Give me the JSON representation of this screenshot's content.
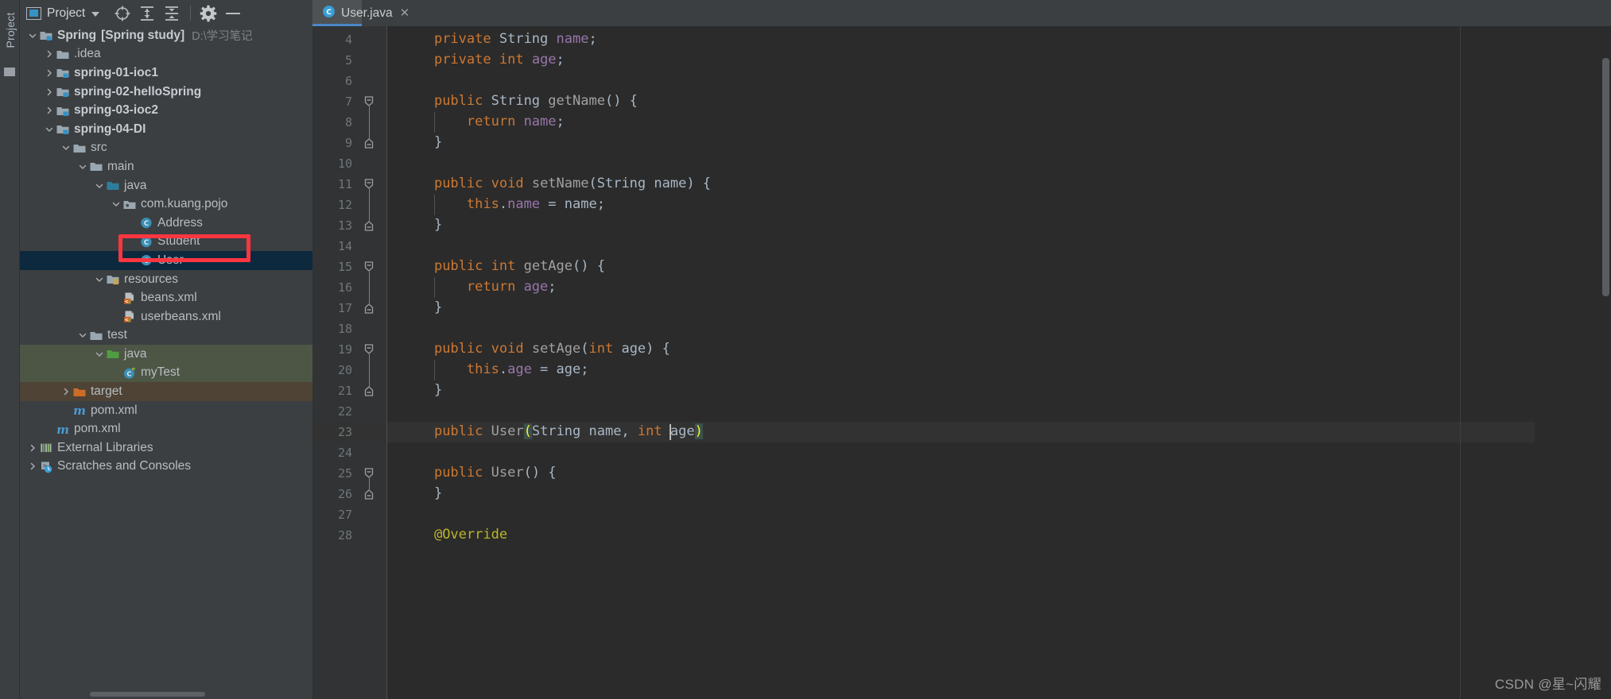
{
  "window": {
    "tool_window_label": "Project"
  },
  "project_header": {
    "title": "Project",
    "icons": [
      {
        "name": "project-view-icon",
        "glyph": "window"
      },
      {
        "name": "caret-down-icon",
        "glyph": "caret"
      },
      {
        "name": "locate-target-icon",
        "glyph": "crosshair"
      },
      {
        "name": "expand-all-icon",
        "glyph": "expand"
      },
      {
        "name": "collapse-all-icon",
        "glyph": "collapse"
      },
      {
        "name": "settings-gear-icon",
        "glyph": "gear"
      },
      {
        "name": "hide-panel-icon",
        "glyph": "minus"
      }
    ]
  },
  "tree": {
    "nodes": [
      {
        "label": "Spring",
        "suffix": "[Spring study]",
        "path": "D:\\学习笔记",
        "icon": "module-folder-icon",
        "depth": 0,
        "arrow": "down",
        "bold": true,
        "state": "normal"
      },
      {
        "label": ".idea",
        "icon": "folder-icon",
        "depth": 1,
        "arrow": "right",
        "bold": false,
        "state": "normal"
      },
      {
        "label": "spring-01-ioc1",
        "icon": "module-folder-icon",
        "depth": 1,
        "arrow": "right",
        "bold": true,
        "state": "normal"
      },
      {
        "label": "spring-02-helloSpring",
        "icon": "module-folder-icon",
        "depth": 1,
        "arrow": "right",
        "bold": true,
        "state": "normal"
      },
      {
        "label": "spring-03-ioc2",
        "icon": "module-folder-icon",
        "depth": 1,
        "arrow": "right",
        "bold": true,
        "state": "normal"
      },
      {
        "label": "spring-04-DI",
        "icon": "module-folder-icon",
        "depth": 1,
        "arrow": "down",
        "bold": true,
        "state": "normal"
      },
      {
        "label": "src",
        "icon": "folder-icon",
        "depth": 2,
        "arrow": "down",
        "bold": false,
        "state": "normal"
      },
      {
        "label": "main",
        "icon": "folder-icon",
        "depth": 3,
        "arrow": "down",
        "bold": false,
        "state": "normal"
      },
      {
        "label": "java",
        "icon": "source-root-icon",
        "depth": 4,
        "arrow": "down",
        "bold": false,
        "state": "normal"
      },
      {
        "label": "com.kuang.pojo",
        "icon": "package-icon",
        "depth": 5,
        "arrow": "down",
        "bold": false,
        "state": "normal"
      },
      {
        "label": "Address",
        "icon": "java-class-icon",
        "depth": 6,
        "arrow": "none",
        "bold": false,
        "state": "normal"
      },
      {
        "label": "Student",
        "icon": "java-class-icon",
        "depth": 6,
        "arrow": "none",
        "bold": false,
        "state": "normal"
      },
      {
        "label": "User",
        "icon": "java-class-icon",
        "depth": 6,
        "arrow": "none",
        "bold": false,
        "state": "selected"
      },
      {
        "label": "resources",
        "icon": "resource-root-icon",
        "depth": 4,
        "arrow": "down",
        "bold": false,
        "state": "normal"
      },
      {
        "label": "beans.xml",
        "icon": "spring-xml-icon",
        "depth": 5,
        "arrow": "none",
        "bold": false,
        "state": "normal"
      },
      {
        "label": "userbeans.xml",
        "icon": "spring-xml-icon",
        "depth": 5,
        "arrow": "none",
        "bold": false,
        "state": "normal"
      },
      {
        "label": "test",
        "icon": "folder-icon",
        "depth": 3,
        "arrow": "down",
        "bold": false,
        "state": "normal"
      },
      {
        "label": "java",
        "icon": "test-source-root-icon",
        "depth": 4,
        "arrow": "down",
        "bold": false,
        "state": "test"
      },
      {
        "label": "myTest",
        "icon": "java-test-class-icon",
        "depth": 5,
        "arrow": "none",
        "bold": false,
        "state": "test"
      },
      {
        "label": "target",
        "icon": "excluded-folder-icon",
        "depth": 2,
        "arrow": "right",
        "bold": false,
        "state": "target"
      },
      {
        "label": "pom.xml",
        "icon": "maven-icon",
        "depth": 2,
        "arrow": "none",
        "bold": false,
        "state": "normal"
      },
      {
        "label": "pom.xml",
        "icon": "maven-icon",
        "depth": 1,
        "arrow": "none",
        "bold": false,
        "state": "normal"
      },
      {
        "label": "External Libraries",
        "icon": "libraries-icon",
        "depth": 0,
        "arrow": "right",
        "bold": false,
        "state": "normal"
      },
      {
        "label": "Scratches and Consoles",
        "icon": "scratches-icon",
        "depth": 0,
        "arrow": "right",
        "bold": false,
        "state": "normal"
      }
    ]
  },
  "editor": {
    "tab": {
      "label": "User.java",
      "icon": "java-class-icon",
      "close": "✕"
    },
    "first_line_number": 4,
    "lines": [
      {
        "num": 4,
        "fold": "none",
        "tokens": [
          {
            "t": "    ",
            "c": "pl"
          },
          {
            "t": "private",
            "c": "kw"
          },
          {
            "t": " ",
            "c": "pl"
          },
          {
            "t": "String",
            "c": "type"
          },
          {
            "t": " ",
            "c": "pl"
          },
          {
            "t": "name",
            "c": "fld"
          },
          {
            "t": ";",
            "c": "pl"
          }
        ]
      },
      {
        "num": 5,
        "fold": "none",
        "tokens": [
          {
            "t": "    ",
            "c": "pl"
          },
          {
            "t": "private",
            "c": "kw"
          },
          {
            "t": " ",
            "c": "pl"
          },
          {
            "t": "int",
            "c": "kw"
          },
          {
            "t": " ",
            "c": "pl"
          },
          {
            "t": "age",
            "c": "fld"
          },
          {
            "t": ";",
            "c": "pl"
          }
        ]
      },
      {
        "num": 6,
        "fold": "none",
        "tokens": []
      },
      {
        "num": 7,
        "fold": "start",
        "tokens": [
          {
            "t": "    ",
            "c": "pl"
          },
          {
            "t": "public",
            "c": "kw"
          },
          {
            "t": " ",
            "c": "pl"
          },
          {
            "t": "String",
            "c": "type"
          },
          {
            "t": " ",
            "c": "pl"
          },
          {
            "t": "getName",
            "c": "mth"
          },
          {
            "t": "() {",
            "c": "pl"
          }
        ]
      },
      {
        "num": 8,
        "fold": "none",
        "tokens": [
          {
            "t": "        ",
            "c": "pl"
          },
          {
            "t": "return",
            "c": "kw"
          },
          {
            "t": " ",
            "c": "pl"
          },
          {
            "t": "name",
            "c": "fld"
          },
          {
            "t": ";",
            "c": "pl"
          }
        ]
      },
      {
        "num": 9,
        "fold": "end",
        "tokens": [
          {
            "t": "    }",
            "c": "pl"
          }
        ]
      },
      {
        "num": 10,
        "fold": "none",
        "tokens": []
      },
      {
        "num": 11,
        "fold": "start",
        "tokens": [
          {
            "t": "    ",
            "c": "pl"
          },
          {
            "t": "public",
            "c": "kw"
          },
          {
            "t": " ",
            "c": "pl"
          },
          {
            "t": "void",
            "c": "kw"
          },
          {
            "t": " ",
            "c": "pl"
          },
          {
            "t": "setName",
            "c": "mth"
          },
          {
            "t": "(",
            "c": "pl"
          },
          {
            "t": "String",
            "c": "type"
          },
          {
            "t": " name) {",
            "c": "pl"
          }
        ]
      },
      {
        "num": 12,
        "fold": "none",
        "tokens": [
          {
            "t": "        ",
            "c": "pl"
          },
          {
            "t": "this",
            "c": "kw"
          },
          {
            "t": ".",
            "c": "pl"
          },
          {
            "t": "name",
            "c": "fld"
          },
          {
            "t": " = name;",
            "c": "pl"
          }
        ]
      },
      {
        "num": 13,
        "fold": "end",
        "tokens": [
          {
            "t": "    }",
            "c": "pl"
          }
        ]
      },
      {
        "num": 14,
        "fold": "none",
        "tokens": []
      },
      {
        "num": 15,
        "fold": "start",
        "tokens": [
          {
            "t": "    ",
            "c": "pl"
          },
          {
            "t": "public",
            "c": "kw"
          },
          {
            "t": " ",
            "c": "pl"
          },
          {
            "t": "int",
            "c": "kw"
          },
          {
            "t": " ",
            "c": "pl"
          },
          {
            "t": "getAge",
            "c": "mth"
          },
          {
            "t": "() {",
            "c": "pl"
          }
        ]
      },
      {
        "num": 16,
        "fold": "none",
        "tokens": [
          {
            "t": "        ",
            "c": "pl"
          },
          {
            "t": "return",
            "c": "kw"
          },
          {
            "t": " ",
            "c": "pl"
          },
          {
            "t": "age",
            "c": "fld"
          },
          {
            "t": ";",
            "c": "pl"
          }
        ]
      },
      {
        "num": 17,
        "fold": "end",
        "tokens": [
          {
            "t": "    }",
            "c": "pl"
          }
        ]
      },
      {
        "num": 18,
        "fold": "none",
        "tokens": []
      },
      {
        "num": 19,
        "fold": "start",
        "tokens": [
          {
            "t": "    ",
            "c": "pl"
          },
          {
            "t": "public",
            "c": "kw"
          },
          {
            "t": " ",
            "c": "pl"
          },
          {
            "t": "void",
            "c": "kw"
          },
          {
            "t": " ",
            "c": "pl"
          },
          {
            "t": "setAge",
            "c": "mth"
          },
          {
            "t": "(",
            "c": "pl"
          },
          {
            "t": "int",
            "c": "kw"
          },
          {
            "t": " age) {",
            "c": "pl"
          }
        ]
      },
      {
        "num": 20,
        "fold": "none",
        "tokens": [
          {
            "t": "        ",
            "c": "pl"
          },
          {
            "t": "this",
            "c": "kw"
          },
          {
            "t": ".",
            "c": "pl"
          },
          {
            "t": "age",
            "c": "fld"
          },
          {
            "t": " = age;",
            "c": "pl"
          }
        ]
      },
      {
        "num": 21,
        "fold": "end",
        "tokens": [
          {
            "t": "    }",
            "c": "pl"
          }
        ]
      },
      {
        "num": 22,
        "fold": "none",
        "tokens": []
      },
      {
        "num": 23,
        "fold": "none",
        "current": true,
        "tokens": [
          {
            "t": "    ",
            "c": "pl"
          },
          {
            "t": "public",
            "c": "kw"
          },
          {
            "t": " ",
            "c": "pl"
          },
          {
            "t": "User",
            "c": "mth"
          },
          {
            "t": "(",
            "c": "brace-hl"
          },
          {
            "t": "String",
            "c": "type"
          },
          {
            "t": " name, ",
            "c": "pl"
          },
          {
            "t": "int",
            "c": "kw"
          },
          {
            "t": " age",
            "c": "pl"
          },
          {
            "t": ")",
            "c": "brace-hl"
          },
          {
            "t": " ",
            "c": "pl"
          }
        ]
      },
      {
        "num": 24,
        "fold": "none",
        "tokens": []
      },
      {
        "num": 25,
        "fold": "start",
        "tokens": [
          {
            "t": "    ",
            "c": "pl"
          },
          {
            "t": "public",
            "c": "kw"
          },
          {
            "t": " ",
            "c": "pl"
          },
          {
            "t": "User",
            "c": "mth"
          },
          {
            "t": "() {",
            "c": "pl"
          }
        ]
      },
      {
        "num": 26,
        "fold": "end",
        "tokens": [
          {
            "t": "    }",
            "c": "pl"
          }
        ]
      },
      {
        "num": 27,
        "fold": "none",
        "tokens": []
      },
      {
        "num": 28,
        "fold": "none",
        "tokens": [
          {
            "t": "    ",
            "c": "pl"
          },
          {
            "t": "@Override",
            "c": "anno"
          }
        ]
      }
    ]
  },
  "watermark": {
    "text": "CSDN @星~闪耀"
  },
  "colors": {
    "panel_bg": "#3c3f41",
    "editor_bg": "#2b2b2b",
    "gutter_bg": "#313335",
    "selection": "#0d293e",
    "annotation_red": "#fb3640",
    "tab_underline": "#4a88c7",
    "keyword": "#cc7832",
    "field": "#9876aa",
    "annotation_token": "#bbb529"
  }
}
